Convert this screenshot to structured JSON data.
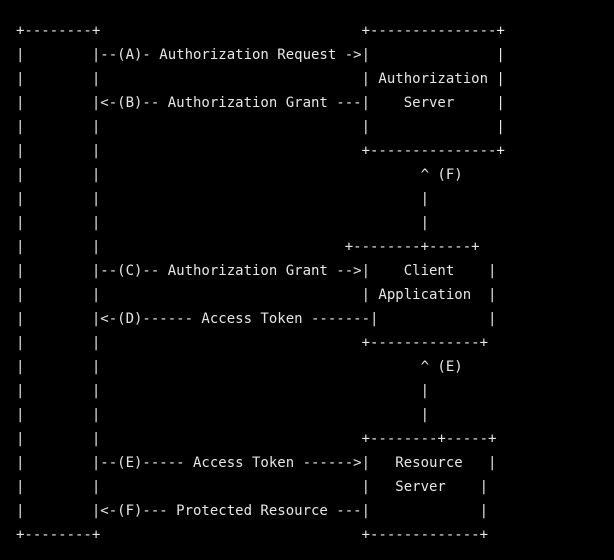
{
  "text_color": "#e6e6e6",
  "background_color": "#000000",
  "diagram_lines": [
    "+--------+                               +---------------+",
    "|        |--(A)- Authorization Request ->|               |",
    "|        |                               | Authorization |",
    "|        |<-(B)-- Authorization Grant ---|    Server     |",
    "|        |                               |               |",
    "|        |                               +---------------+",
    "|        |                                      ^ (F)",
    "|        |                                      |",
    "|        |                                      |",
    "|        |                             +--------+-----+",
    "|        |--(C)-- Authorization Grant -->|    Client    |",
    "|        |                               | Application  |",
    "|        |<-(D)------ Access Token -------|             |",
    "|        |                               +-------------+",
    "|        |                                      ^ (E)",
    "|        |                                      |",
    "|        |                                      |",
    "|        |                               +--------+-----+",
    "|        |--(E)----- Access Token ------>|   Resource   |",
    "|        |                               |   Server    |",
    "|        |<-(F)--- Protected Resource ---|             |",
    "+--------+                               +-------------+"
  ]
}
